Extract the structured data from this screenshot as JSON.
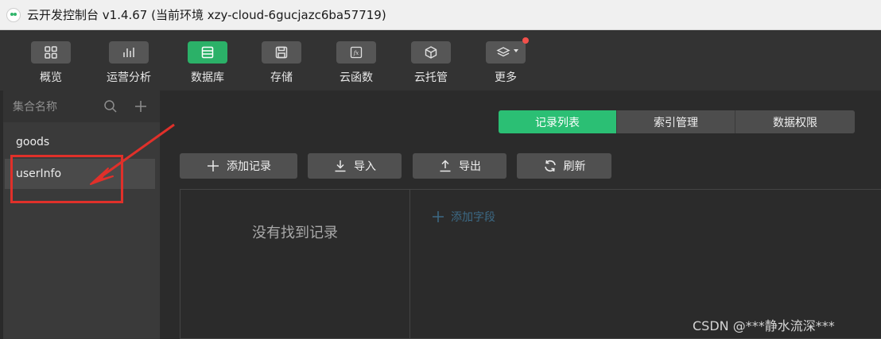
{
  "window": {
    "title": "云开发控制台 v1.4.67 (当前环境 xzy-cloud-6gucjazc6ba57719)"
  },
  "toolbar": {
    "items": [
      {
        "label": "概览",
        "icon": "grid-icon"
      },
      {
        "label": "运营分析",
        "icon": "bar-chart-icon"
      },
      {
        "label": "数据库",
        "icon": "database-icon",
        "active": true
      },
      {
        "label": "存储",
        "icon": "storage-icon"
      },
      {
        "label": "云函数",
        "icon": "function-icon"
      },
      {
        "label": "云托管",
        "icon": "cube-icon"
      },
      {
        "label": "更多",
        "icon": "layers-icon",
        "notification_dot": true
      }
    ]
  },
  "sidebar": {
    "header": "集合名称",
    "collections": [
      {
        "name": "goods",
        "selected": false
      },
      {
        "name": "userInfo",
        "selected": true
      }
    ]
  },
  "main": {
    "tabs": [
      {
        "label": "记录列表",
        "active": true
      },
      {
        "label": "索引管理",
        "active": false
      },
      {
        "label": "数据权限",
        "active": false
      }
    ],
    "actions": {
      "add_record": "添加记录",
      "import": "导入",
      "export": "导出",
      "refresh": "刷新"
    },
    "empty_state": "没有找到记录",
    "add_field": "添加字段"
  },
  "watermark": "CSDN @***静水流深***",
  "colors": {
    "accent_green": "#2bbf74",
    "annotation_red": "#e0302a",
    "notification_red": "#f2504b"
  }
}
